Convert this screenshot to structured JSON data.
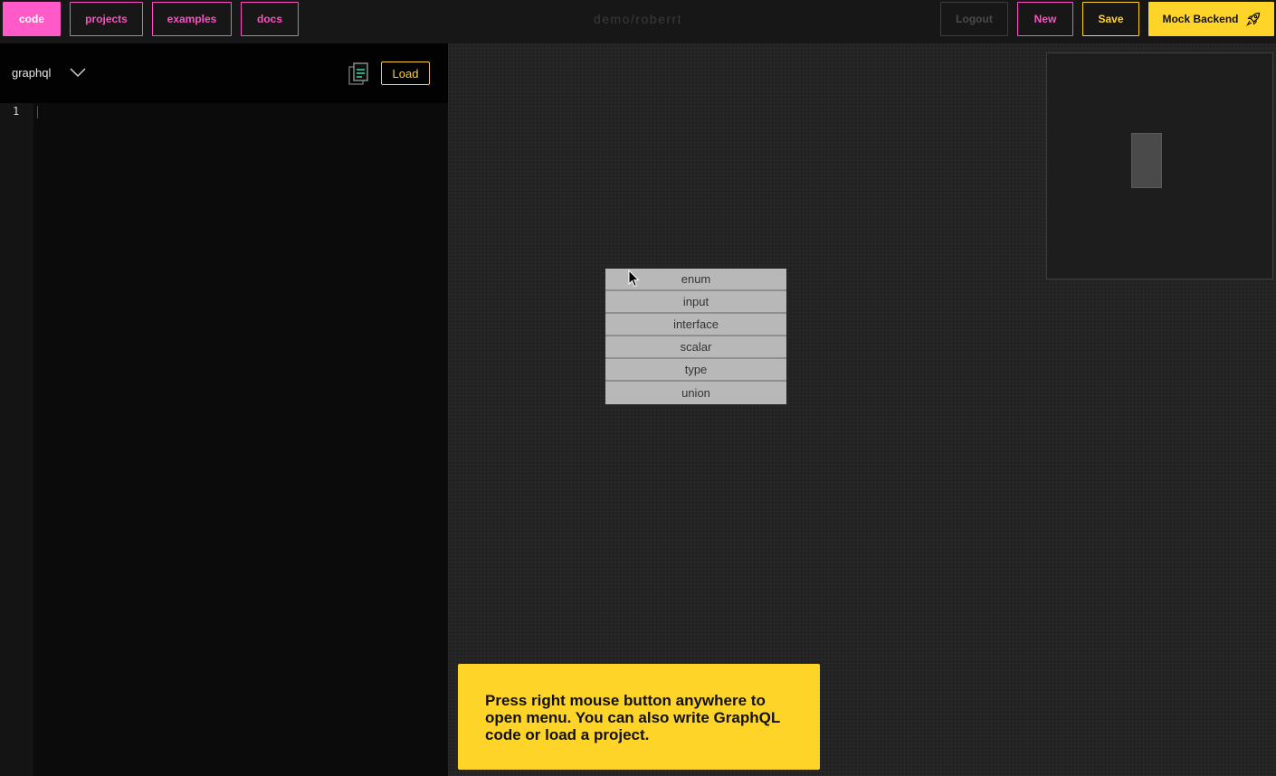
{
  "nav": {
    "code": "code",
    "projects": "projects",
    "examples": "examples",
    "docs": "docs"
  },
  "header": {
    "title": "demo/roberrt",
    "logout": "Logout",
    "new": "New",
    "save": "Save",
    "mock_backend": "Mock Backend"
  },
  "editor": {
    "language": "graphql",
    "load": "Load",
    "line_numbers": [
      "1"
    ]
  },
  "context_menu": {
    "items": [
      "enum",
      "input",
      "interface",
      "scalar",
      "type",
      "union"
    ]
  },
  "toast": {
    "message": "Press right mouse button anywhere to open menu. You can also write GraphQL code or load a project."
  },
  "colors": {
    "accent_pink": "#ff5ac8",
    "accent_yellow": "#ffd429"
  }
}
